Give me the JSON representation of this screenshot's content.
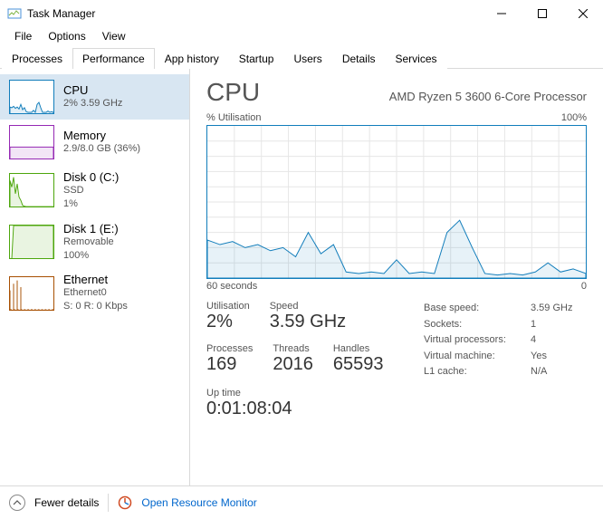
{
  "window": {
    "title": "Task Manager"
  },
  "menus": [
    "File",
    "Options",
    "View"
  ],
  "tabs": [
    "Processes",
    "Performance",
    "App history",
    "Startup",
    "Users",
    "Details",
    "Services"
  ],
  "active_tab": "Performance",
  "sidebar": {
    "items": [
      {
        "name": "CPU",
        "sub": "2%  3.59 GHz",
        "color": "#117dbb"
      },
      {
        "name": "Memory",
        "sub": "2.9/8.0 GB (36%)",
        "color": "#9528b4"
      },
      {
        "name": "Disk 0 (C:)",
        "sub": "SSD\n1%",
        "color": "#4da60c"
      },
      {
        "name": "Disk 1 (E:)",
        "sub": "Removable\n100%",
        "color": "#4da60c"
      },
      {
        "name": "Ethernet",
        "sub": "Ethernet0\nS: 0  R: 0 Kbps",
        "color": "#a74f01"
      }
    ]
  },
  "detail": {
    "title": "CPU",
    "subtitle": "AMD Ryzen 5 3600 6-Core Processor",
    "chart_top_left": "% Utilisation",
    "chart_top_right": "100%",
    "chart_bottom_left": "60 seconds",
    "chart_bottom_right": "0",
    "stats": {
      "utilisation_label": "Utilisation",
      "utilisation": "2%",
      "speed_label": "Speed",
      "speed": "3.59 GHz",
      "processes_label": "Processes",
      "processes": "169",
      "threads_label": "Threads",
      "threads": "2016",
      "handles_label": "Handles",
      "handles": "65593",
      "uptime_label": "Up time",
      "uptime": "0:01:08:04"
    },
    "right_stats": [
      {
        "k": "Base speed:",
        "v": "3.59 GHz"
      },
      {
        "k": "Sockets:",
        "v": "1"
      },
      {
        "k": "Virtual processors:",
        "v": "4"
      },
      {
        "k": "Virtual machine:",
        "v": "Yes"
      },
      {
        "k": "L1 cache:",
        "v": "N/A"
      }
    ]
  },
  "footer": {
    "fewer": "Fewer details",
    "monitor": "Open Resource Monitor"
  },
  "chart_data": {
    "type": "line",
    "title": "% Utilisation",
    "xlabel": "seconds",
    "ylabel": "% Utilisation",
    "ylim": [
      0,
      100
    ],
    "xlim": [
      60,
      0
    ],
    "x": [
      60,
      58,
      56,
      54,
      52,
      50,
      48,
      46,
      44,
      42,
      40,
      38,
      36,
      34,
      32,
      30,
      28,
      26,
      24,
      22,
      20,
      18,
      16,
      14,
      12,
      10,
      8,
      6,
      4,
      2,
      0
    ],
    "values": [
      25,
      22,
      24,
      20,
      22,
      18,
      20,
      14,
      30,
      16,
      22,
      4,
      3,
      4,
      3,
      12,
      3,
      4,
      3,
      30,
      38,
      20,
      3,
      2,
      3,
      2,
      4,
      10,
      4,
      6,
      3
    ]
  },
  "sidebar_charts": {
    "cpu": [
      20,
      18,
      22,
      16,
      20,
      14,
      28,
      12,
      18,
      6,
      4,
      4,
      4,
      10,
      4,
      28,
      34,
      18,
      4,
      4,
      4,
      8,
      4,
      6,
      4
    ],
    "memory": [
      36,
      36,
      36,
      36,
      36,
      36,
      36,
      36,
      36,
      36,
      36,
      36,
      36,
      36,
      36,
      36,
      36,
      36,
      36,
      36,
      36,
      36,
      36,
      36,
      36
    ],
    "disk0": [
      80,
      60,
      90,
      40,
      70,
      30,
      20,
      5,
      2,
      1,
      1,
      1,
      1,
      1,
      1,
      1,
      1,
      1,
      1,
      1,
      1,
      1,
      1,
      1,
      1
    ],
    "disk1": [
      0,
      0,
      100,
      100,
      100,
      100,
      100,
      100,
      100,
      100,
      100,
      100,
      100,
      100,
      100,
      100,
      100,
      100,
      100,
      100,
      100,
      100,
      100,
      100,
      100
    ],
    "ethernet": [
      60,
      0,
      80,
      0,
      90,
      0,
      70,
      0,
      0,
      0,
      0,
      0,
      0,
      0,
      0,
      0,
      0,
      0,
      0,
      0,
      0,
      0,
      0,
      0,
      0
    ]
  }
}
